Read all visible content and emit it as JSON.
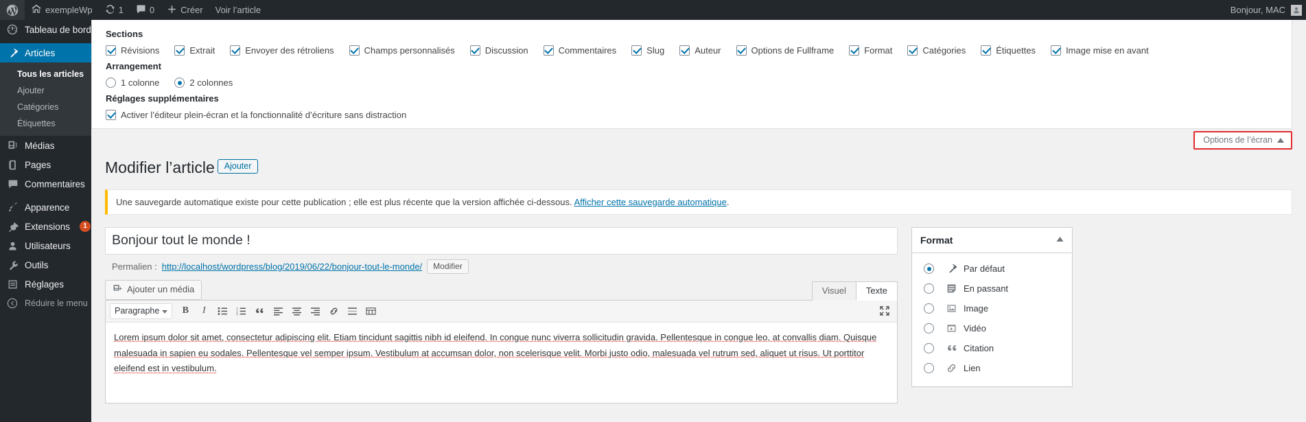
{
  "adminbar": {
    "logo_icon": "wordpress-logo-icon",
    "site_icon": "home-icon",
    "site_name": "exempleWp",
    "updates_icon": "updates-icon",
    "updates_count": "1",
    "comments_icon": "comment-bubble-icon",
    "comments_count": "0",
    "new_icon": "plus-icon",
    "new_label": "Créer",
    "view_post_label": "Voir l’article",
    "howdy": "Bonjour, MAC",
    "avatar_icon": "user-avatar-icon"
  },
  "sidebar": {
    "items": [
      {
        "label": "Tableau de bord",
        "icon": "dashboard-gauge-icon",
        "current": false
      },
      {
        "label": "Articles",
        "icon": "pin-icon",
        "current": true
      },
      {
        "label": "Médias",
        "icon": "media-icon",
        "current": false
      },
      {
        "label": "Pages",
        "icon": "pages-icon",
        "current": false
      },
      {
        "label": "Commentaires",
        "icon": "comment-bubble-icon",
        "current": false
      },
      {
        "label": "Apparence",
        "icon": "paintbrush-icon",
        "current": false
      },
      {
        "label": "Extensions",
        "icon": "plug-icon",
        "current": false,
        "badge": "1"
      },
      {
        "label": "Utilisateurs",
        "icon": "user-icon",
        "current": false
      },
      {
        "label": "Outils",
        "icon": "wrench-icon",
        "current": false
      },
      {
        "label": "Réglages",
        "icon": "settings-sliders-icon",
        "current": false
      }
    ],
    "submenu": [
      {
        "label": "Tous les articles",
        "current": true
      },
      {
        "label": "Ajouter",
        "current": false
      },
      {
        "label": "Catégories",
        "current": false
      },
      {
        "label": "Étiquettes",
        "current": false
      }
    ],
    "collapse_label": "Réduire le menu",
    "collapse_icon": "collapse-arrow-icon"
  },
  "screen_options": {
    "sections_heading": "Sections",
    "sections": [
      {
        "label": "Révisions",
        "checked": true
      },
      {
        "label": "Extrait",
        "checked": true
      },
      {
        "label": "Envoyer des rétroliens",
        "checked": true
      },
      {
        "label": "Champs personnalisés",
        "checked": true
      },
      {
        "label": "Discussion",
        "checked": true
      },
      {
        "label": "Commentaires",
        "checked": true
      },
      {
        "label": "Slug",
        "checked": true
      },
      {
        "label": "Auteur",
        "checked": true
      },
      {
        "label": "Options de Fullframe",
        "checked": true
      },
      {
        "label": "Format",
        "checked": true
      },
      {
        "label": "Catégories",
        "checked": true
      },
      {
        "label": "Étiquettes",
        "checked": true
      },
      {
        "label": "Image mise en avant",
        "checked": true
      }
    ],
    "layout_heading": "Arrangement",
    "layout_options": [
      {
        "label": "1 colonne",
        "selected": false
      },
      {
        "label": "2 colonnes",
        "selected": true
      }
    ],
    "extra_heading": "Réglages supplémentaires",
    "extra_option": {
      "label": "Activer l’éditeur plein-écran et la fonctionnalité d’écriture sans distraction",
      "checked": true
    },
    "toggle_label": "Options de l’écran",
    "toggle_icon": "chevron-up-icon",
    "toggle_border_color": "#e02a2a"
  },
  "page": {
    "title": "Modifier l’article",
    "add_new_label": "Ajouter",
    "notice_text": "Une sauvegarde automatique existe pour cette publication ; elle est plus récente que la version affichée ci-dessous. ",
    "notice_link": "Afficher cette sauvegarde automatique",
    "notice_tail": "."
  },
  "editor": {
    "post_title": "Bonjour tout le monde !",
    "post_title_placeholder": "Saisissez le titre",
    "permalink_label": "Permalien :",
    "permalink_prefix": "http://localhost/wordpress/blog/2019/06/22/",
    "permalink_slug": "bonjour-tout-le-monde/",
    "permalink_edit_label": "Modifier",
    "add_media_label": "Ajouter un média",
    "add_media_icon": "media-add-icon",
    "tab_visual": "Visuel",
    "tab_text": "Texte",
    "active_tab": "Visuel",
    "toolbar": {
      "paragraph_select": "Paragraphe",
      "buttons": [
        {
          "icon": "bold-icon",
          "glyph": "B"
        },
        {
          "icon": "italic-icon",
          "glyph": "I"
        },
        {
          "icon": "bulleted-list-icon",
          "glyph": ""
        },
        {
          "icon": "numbered-list-icon",
          "glyph": ""
        },
        {
          "icon": "blockquote-icon",
          "glyph": "❝"
        },
        {
          "icon": "align-left-icon",
          "glyph": ""
        },
        {
          "icon": "align-center-icon",
          "glyph": ""
        },
        {
          "icon": "align-right-icon",
          "glyph": ""
        },
        {
          "icon": "insert-link-icon",
          "glyph": ""
        },
        {
          "icon": "read-more-icon",
          "glyph": ""
        },
        {
          "icon": "toolbar-toggle-icon",
          "glyph": ""
        }
      ],
      "fullscreen_icon": "fullscreen-icon"
    },
    "content": "Lorem ipsum dolor sit amet, consectetur adipiscing elit. Etiam tincidunt sagittis nibh id eleifend. In congue nunc viverra sollicitudin gravida. Pellentesque in congue leo, at convallis diam. Quisque malesuada in sapien eu sodales. Pellentesque vel semper ipsum. Vestibulum at accumsan dolor, non scelerisque velit. Morbi justo odio, malesuada vel rutrum sed, aliquet ut risus. Ut porttitor eleifend est in vestibulum."
  },
  "format_box": {
    "title": "Format",
    "toggle_icon": "chevron-up-icon",
    "options": [
      {
        "label": "Par défaut",
        "icon": "pin-icon",
        "selected": true
      },
      {
        "label": "En passant",
        "icon": "aside-note-icon",
        "selected": false
      },
      {
        "label": "Image",
        "icon": "image-icon",
        "selected": false
      },
      {
        "label": "Vidéo",
        "icon": "video-icon",
        "selected": false
      },
      {
        "label": "Citation",
        "icon": "quote-icon",
        "selected": false
      },
      {
        "label": "Lien",
        "icon": "link-icon",
        "selected": false
      }
    ]
  },
  "colors": {
    "admin_bar": "#23282d",
    "accent": "#0073aa",
    "current_menu": "#0073aa",
    "badge": "#d54e21",
    "notice": "#ffb900",
    "highlight_border": "#e02a2a"
  }
}
